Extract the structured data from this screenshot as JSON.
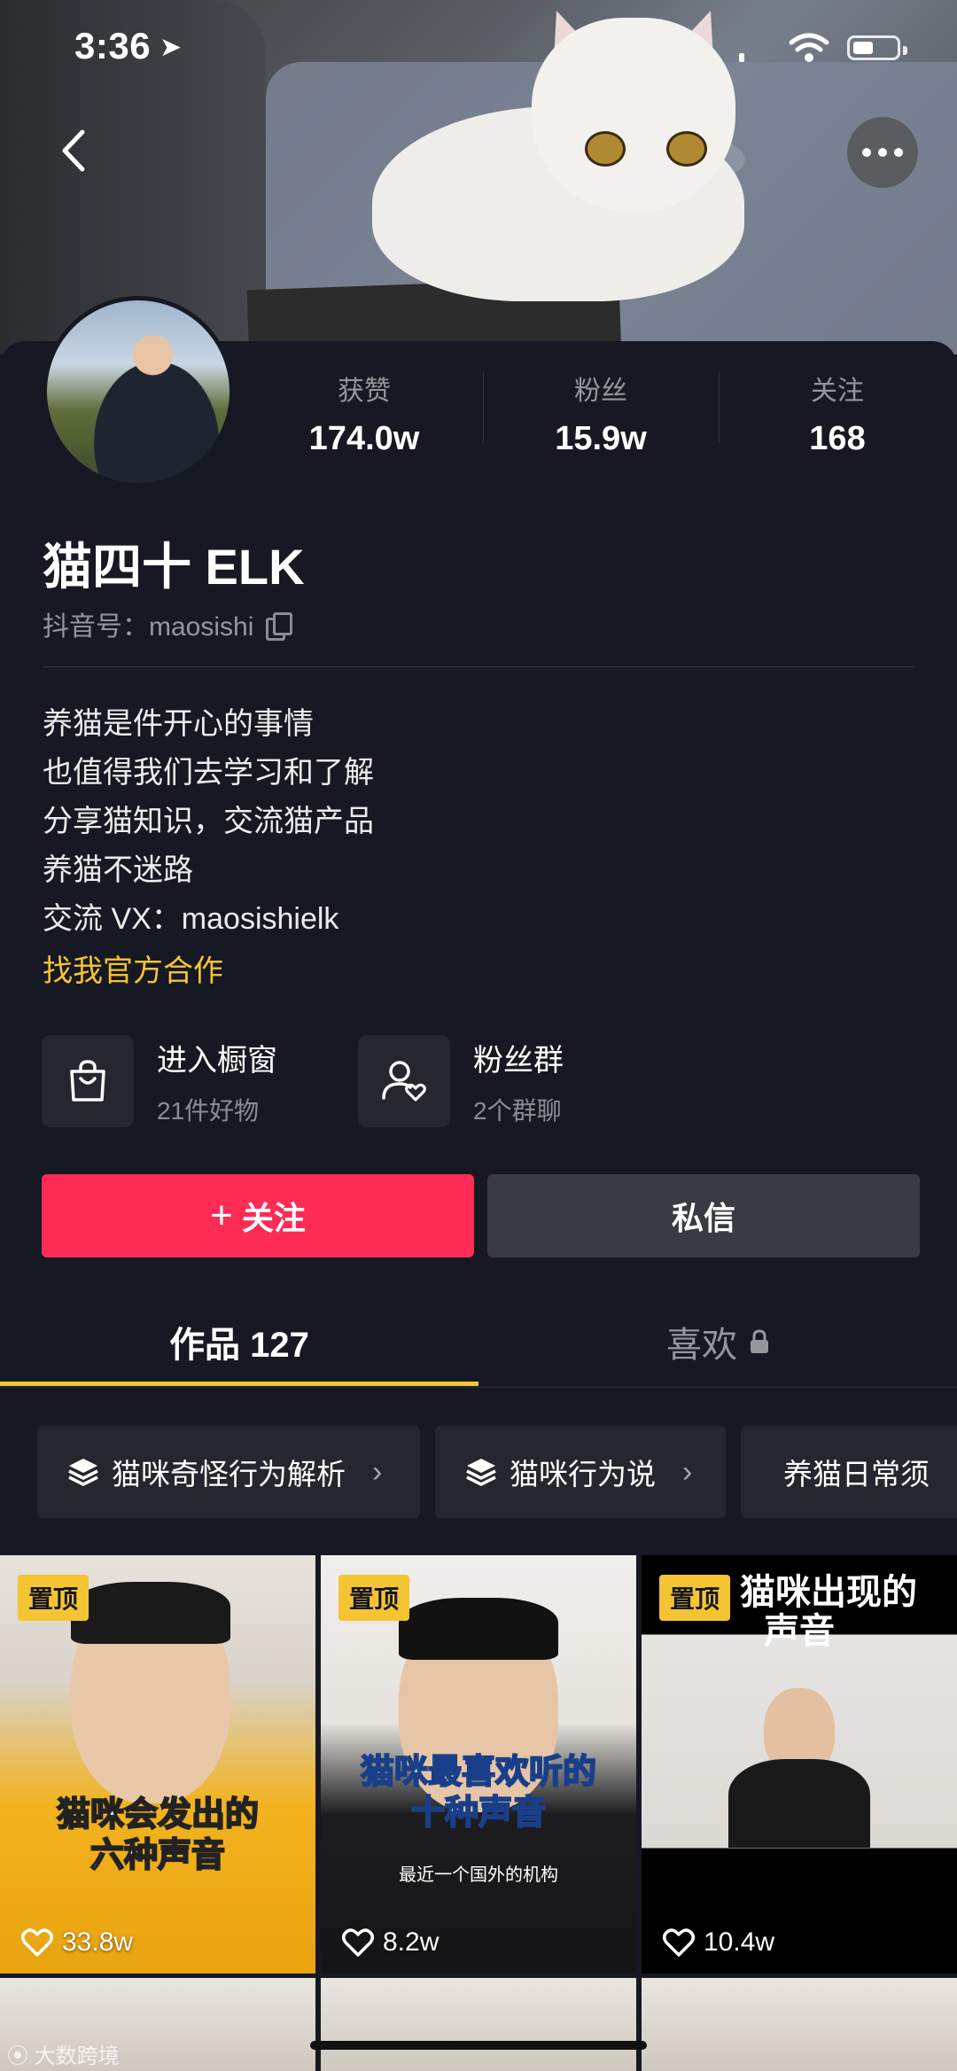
{
  "status_bar": {
    "time": "3:36"
  },
  "profile": {
    "name": "猫四十 ELK",
    "handle": "抖音号：maosishi",
    "stats": [
      {
        "label": "获赞",
        "value": "174.0w"
      },
      {
        "label": "粉丝",
        "value": "15.9w"
      },
      {
        "label": "关注",
        "value": "168"
      }
    ],
    "bio": [
      "养猫是件开心的事情",
      "也值得我们去学习和了解",
      "分享猫知识，交流猫产品",
      "养猫不迷路",
      "交流 VX：maosishielk"
    ],
    "cooperation_link": "找我官方合作"
  },
  "entries": [
    {
      "title": "进入橱窗",
      "subtitle": "21件好物",
      "icon": "shopping-bag-icon"
    },
    {
      "title": "粉丝群",
      "subtitle": "2个群聊",
      "icon": "fan-group-icon"
    }
  ],
  "actions": {
    "follow": "关注",
    "message": "私信"
  },
  "tabs": {
    "works": "作品 127",
    "likes": "喜欢"
  },
  "collections": [
    "猫咪奇怪行为解析",
    "猫咪行为说",
    "养猫日常须"
  ],
  "videos": [
    {
      "pinned": "置顶",
      "caption": [
        "猫咪会发出的",
        "六种声音"
      ],
      "likes": "33.8w"
    },
    {
      "pinned": "置顶",
      "caption": [
        "猫咪最喜欢听的",
        "十种声音"
      ],
      "subcaption": "最近一个国外的机构",
      "likes": "8.2w"
    },
    {
      "pinned": "置顶",
      "caption": [
        "猫咪出现的",
        "声音"
      ],
      "likes": "10.4w"
    }
  ],
  "watermark": "大数跨境",
  "colors": {
    "background": "#161823",
    "accent": "#fe2c55",
    "highlight": "#f5c433"
  }
}
